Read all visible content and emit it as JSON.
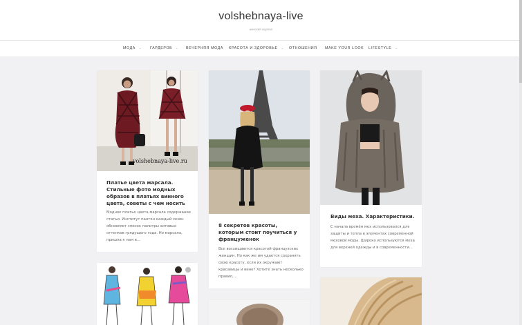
{
  "site": {
    "title": "volshebnaya-live",
    "tagline": "женский журнал"
  },
  "nav": [
    {
      "label": "МОДА",
      "has_dropdown": true
    },
    {
      "label": "ГАРДЕРОБ",
      "has_dropdown": true
    },
    {
      "label": "ВЕЧЕРНЯЯ МОДА",
      "has_dropdown": false
    },
    {
      "label": "КРАСОТА И ЗДОРОВЬЕ",
      "has_dropdown": true
    },
    {
      "label": "ОТНОШЕНИЯ",
      "has_dropdown": false
    },
    {
      "label": "MAKE YOUR LOOK",
      "has_dropdown": false
    },
    {
      "label": "LIFESTYLE",
      "has_dropdown": true
    }
  ],
  "posts": [
    {
      "title": "Платье цвета марсала. Стильные фото модных образов в платьях винного цвета, советы с чем носить",
      "excerpt": "Модное платье цвета марсала содержание статьи. Институт пантон каждый сезон обновляет список палитры хитовых оттенков грядущего года. Но марсала, пришла к нам в...",
      "watermark": "volshebnaya-live.ru"
    },
    {
      "title": "8 секретов красоты, которым стоит поучиться у француженок",
      "excerpt": "Все восхищаются красотой французских женщин. Но как же им удается сохранять свою красоту, если их окружают красавицы и вино? Хотите знать несколько правил,..."
    },
    {
      "title": "Виды меха. Характеристики.",
      "excerpt": "С начала времён мех использовался для защиты и тепла в элементах современной меховой моды. Широко используются меха для верхней одежды и в современности..."
    }
  ],
  "colors": {
    "background": "#f1f1f3",
    "card": "#ffffff",
    "text": "#333333"
  }
}
